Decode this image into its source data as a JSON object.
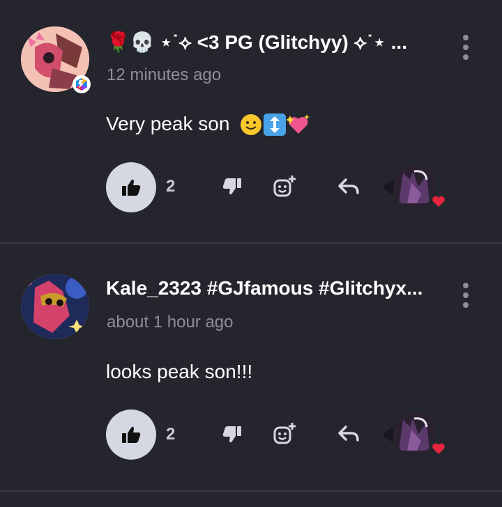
{
  "comments": [
    {
      "username": "🌹💀 ⋆˙⟡ <3 PG (Glitchyy) ⟡˙⋆ ...",
      "timestamp": "12 minutes ago",
      "text": "Very peak son",
      "emojis": [
        "slightly-smiling-face",
        "up-down-arrow",
        "sparkling-heart"
      ],
      "likes": "2"
    },
    {
      "username": "Kale_2323 #GJfamous #Glitchyx...",
      "timestamp": "about 1 hour ago",
      "text": "looks peak son!!!",
      "emojis": [],
      "likes": "2"
    }
  ],
  "icons": {
    "like": "thumbs-up-icon",
    "dislike": "thumbs-down-icon",
    "react": "add-reaction-icon",
    "reply": "reply-icon",
    "more": "more-options-icon",
    "heart": "heart-icon"
  },
  "colors": {
    "background": "#25252d",
    "divider": "#3a3a44",
    "muted_text": "#8f8f99",
    "like_button_bg": "#d5d7e3",
    "heart": "#e8253f"
  }
}
